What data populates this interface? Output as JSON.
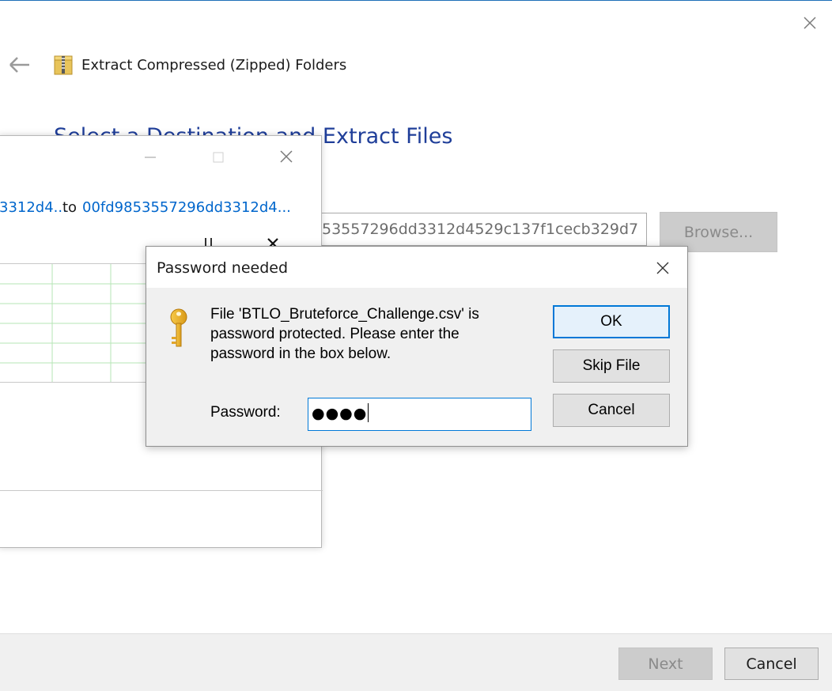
{
  "wizard": {
    "title": "Extract Compressed (Zipped) Folders",
    "heading": "Select a Destination and Extract Files",
    "destination_label_tail": ":",
    "destination_path": "53557296dd3312d4529c137f1cecb329d7",
    "browse_label": "Browse...",
    "next_label": "Next",
    "cancel_label": "Cancel"
  },
  "progress": {
    "from_text": "3312d4...",
    "to_text": "to",
    "dest_text": "00fd9853557296dd3312d4..."
  },
  "password_dialog": {
    "title": "Password needed",
    "message": "File 'BTLO_Bruteforce_Challenge.csv' is password protected.  Please enter the password in the box below.",
    "password_label": "Password:",
    "password_masked": "●●●●",
    "ok_label": "OK",
    "skip_label": "Skip File",
    "cancel_label": "Cancel"
  },
  "colors": {
    "accent": "#0078d7",
    "heading": "#1f3e99",
    "link": "#0066cc",
    "dialog_bg": "#f0f0f0",
    "disabled_button": "#cccccc",
    "graph_grid": "#b6e5b6"
  },
  "icons": [
    "close-icon",
    "back-arrow-icon",
    "zip-folder-icon",
    "minimize-icon",
    "maximize-icon",
    "pause-icon",
    "stop-icon",
    "key-icon"
  ]
}
